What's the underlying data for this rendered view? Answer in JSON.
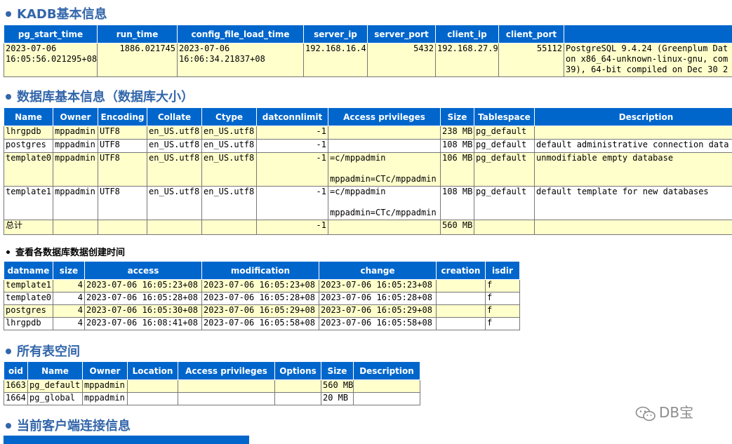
{
  "sections": {
    "kadb": "KADB基本信息",
    "database": "数据库基本信息（数据库大小）",
    "creation": "查看各数据库数据创建时间",
    "tablespace": "所有表空间",
    "client": "当前客户端连接信息"
  },
  "kadb_table": {
    "headers": [
      "pg_start_time",
      "run_time",
      "config_file_load_time",
      "server_ip",
      "server_port",
      "client_ip",
      "client_port",
      ""
    ],
    "row": {
      "pg_start_time": "2023-07-06\n16:05:56.021295+08",
      "run_time": "1886.021745",
      "config_file_load_time": "2023-07-06\n16:06:34.21837+08",
      "server_ip": "192.168.16.4",
      "server_port": "5432",
      "client_ip": "192.168.27.9",
      "client_port": "55112",
      "version": "PostgreSQL 9.4.24 (Greenplum Dat\non x86_64-unknown-linux-gnu, com\n39), 64-bit compiled on Dec 30 2"
    }
  },
  "db_table": {
    "headers": [
      "Name",
      "Owner",
      "Encoding",
      "Collate",
      "Ctype",
      "datconnlimit",
      "Access privileges",
      "Size",
      "Tablespace",
      "Description"
    ],
    "rows": [
      {
        "name": "lhrgpdb",
        "owner": "mppadmin",
        "encoding": "UTF8",
        "collate": "en_US.utf8",
        "ctype": "en_US.utf8",
        "connlimit": "-1",
        "privileges": "",
        "size": "238 MB",
        "tablespace": "pg_default",
        "description": ""
      },
      {
        "name": "postgres",
        "owner": "mppadmin",
        "encoding": "UTF8",
        "collate": "en_US.utf8",
        "ctype": "en_US.utf8",
        "connlimit": "-1",
        "privileges": "",
        "size": "108 MB",
        "tablespace": "pg_default",
        "description": "default administrative connection data"
      },
      {
        "name": "template0",
        "owner": "mppadmin",
        "encoding": "UTF8",
        "collate": "en_US.utf8",
        "ctype": "en_US.utf8",
        "connlimit": "-1",
        "privileges": "=c/mppadmin\n\nmppadmin=CTc/mppadmin",
        "size": "106 MB",
        "tablespace": "pg_default",
        "description": "unmodifiable empty database"
      },
      {
        "name": "template1",
        "owner": "mppadmin",
        "encoding": "UTF8",
        "collate": "en_US.utf8",
        "ctype": "en_US.utf8",
        "connlimit": "-1",
        "privileges": "=c/mppadmin\n\nmppadmin=CTc/mppadmin",
        "size": "108 MB",
        "tablespace": "pg_default",
        "description": "default template for new databases"
      },
      {
        "name": "总计",
        "owner": "",
        "encoding": "",
        "collate": "",
        "ctype": "",
        "connlimit": "-1",
        "privileges": "",
        "size": "560 MB",
        "tablespace": "",
        "description": ""
      }
    ]
  },
  "creation_table": {
    "headers": [
      "datname",
      "size",
      "access",
      "modification",
      "change",
      "creation",
      "isdir"
    ],
    "rows": [
      {
        "datname": "template1",
        "size": "4",
        "access": "2023-07-06 16:05:23+08",
        "modification": "2023-07-06 16:05:23+08",
        "change": "2023-07-06 16:05:23+08",
        "creation": "",
        "isdir": "f"
      },
      {
        "datname": "template0",
        "size": "4",
        "access": "2023-07-06 16:05:28+08",
        "modification": "2023-07-06 16:05:28+08",
        "change": "2023-07-06 16:05:28+08",
        "creation": "",
        "isdir": "f"
      },
      {
        "datname": "postgres",
        "size": "4",
        "access": "2023-07-06 16:05:30+08",
        "modification": "2023-07-06 16:05:29+08",
        "change": "2023-07-06 16:05:29+08",
        "creation": "",
        "isdir": "f"
      },
      {
        "datname": "lhrgpdb",
        "size": "4",
        "access": "2023-07-06 16:08:41+08",
        "modification": "2023-07-06 16:05:58+08",
        "change": "2023-07-06 16:05:58+08",
        "creation": "",
        "isdir": "f"
      }
    ]
  },
  "tablespace_table": {
    "headers": [
      "oid",
      "Name",
      "Owner",
      "Location",
      "Access privileges",
      "Options",
      "Size",
      "Description"
    ],
    "rows": [
      {
        "oid": "1663",
        "name": "pg_default",
        "owner": "mppadmin",
        "location": "",
        "privileges": "",
        "options": "",
        "size": "560 MB",
        "description": ""
      },
      {
        "oid": "1664",
        "name": "pg_global",
        "owner": "mppadmin",
        "location": "",
        "privileges": "",
        "options": "",
        "size": "20 MB",
        "description": ""
      }
    ]
  },
  "watermark": {
    "text": "DB宝",
    "icon": "wechat-icon"
  },
  "colors": {
    "header_bg": "#0066cc",
    "title": "#3366aa",
    "row_alt": "#ffffcc"
  }
}
